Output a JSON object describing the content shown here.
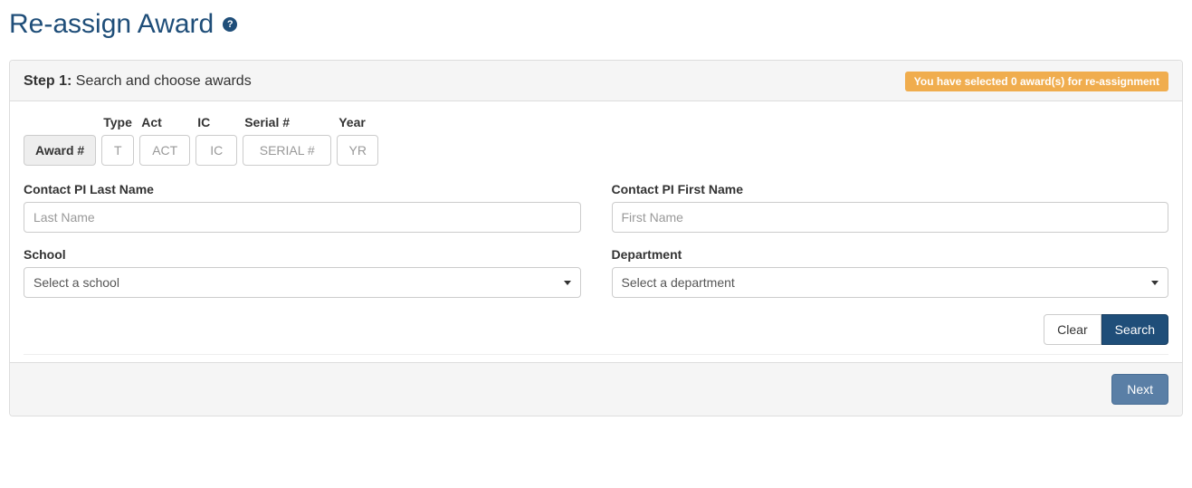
{
  "page": {
    "title": "Re-assign Award",
    "help_icon": "?"
  },
  "step": {
    "label_bold": "Step 1:",
    "label_rest": " Search and choose awards"
  },
  "badge": {
    "prefix": "You have selected ",
    "count": "0",
    "suffix": " award(s) for re-assignment"
  },
  "award": {
    "group_label": "Award #",
    "type": {
      "label": "Type",
      "placeholder": "T"
    },
    "act": {
      "label": "Act",
      "placeholder": "ACT"
    },
    "ic": {
      "label": "IC",
      "placeholder": "IC"
    },
    "serial": {
      "label": "Serial #",
      "placeholder": "SERIAL #"
    },
    "year": {
      "label": "Year",
      "placeholder": "YR"
    }
  },
  "fields": {
    "pi_last": {
      "label": "Contact PI Last Name",
      "placeholder": "Last Name"
    },
    "pi_first": {
      "label": "Contact PI First Name",
      "placeholder": "First Name"
    },
    "school": {
      "label": "School",
      "selected": "Select a school"
    },
    "dept": {
      "label": "Department",
      "selected": "Select a department"
    }
  },
  "buttons": {
    "clear": "Clear",
    "search": "Search",
    "next": "Next"
  }
}
